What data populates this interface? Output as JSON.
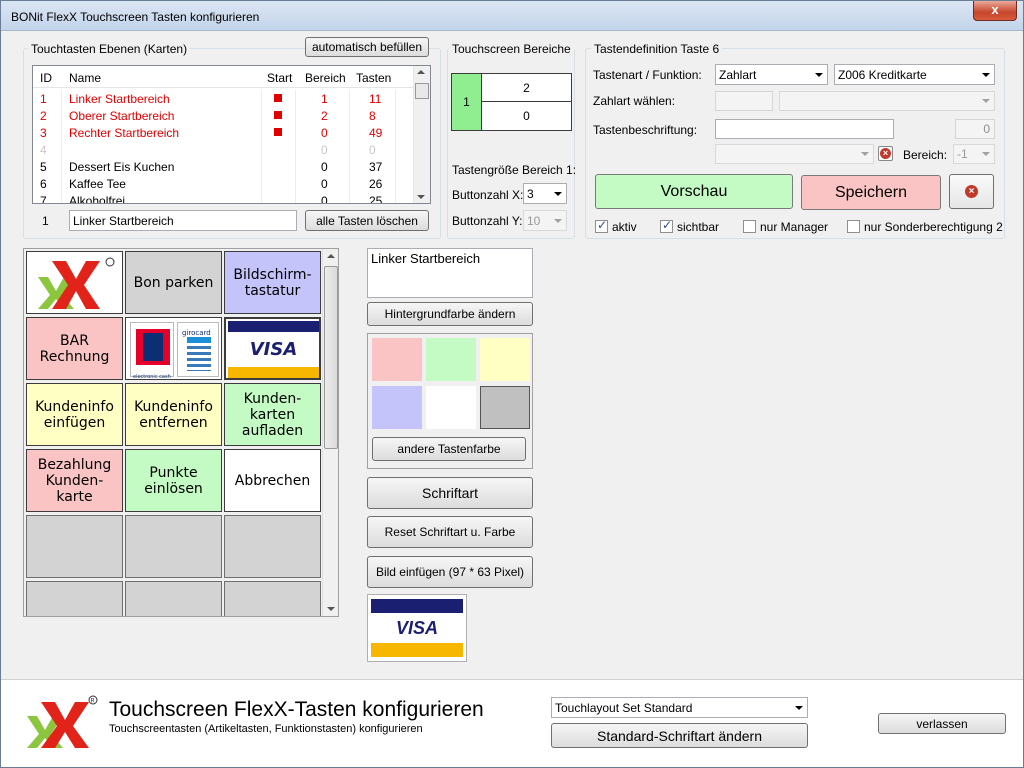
{
  "window": {
    "title": "BONit FlexX Touchscreen Tasten konfigurieren",
    "close": "x"
  },
  "layers": {
    "group_label": "Touchtasten Ebenen (Karten)",
    "autofill_button": "automatisch befüllen",
    "columns": [
      "ID",
      "Name",
      "Start",
      "Bereich",
      "Tasten"
    ],
    "rows": [
      {
        "id": "1",
        "name": "Linker Startbereich",
        "start": true,
        "bereich": "1",
        "tasten": "11",
        "style": "red"
      },
      {
        "id": "2",
        "name": "Oberer Startbereich",
        "start": true,
        "bereich": "2",
        "tasten": "8",
        "style": "red"
      },
      {
        "id": "3",
        "name": "Rechter Startbereich",
        "start": true,
        "bereich": "0",
        "tasten": "49",
        "style": "red"
      },
      {
        "id": "4",
        "name": "",
        "start": false,
        "bereich": "0",
        "tasten": "0",
        "style": "grey"
      },
      {
        "id": "5",
        "name": "Dessert Eis Kuchen",
        "start": false,
        "bereich": "0",
        "tasten": "37",
        "style": "normal"
      },
      {
        "id": "6",
        "name": "Kaffee Tee",
        "start": false,
        "bereich": "0",
        "tasten": "26",
        "style": "normal"
      },
      {
        "id": "7",
        "name": "Alkoholfrei",
        "start": false,
        "bereich": "0",
        "tasten": "25",
        "style": "normal"
      }
    ],
    "selected_id": "1",
    "selected_name": "Linker Startbereich",
    "delete_all_button": "alle Tasten löschen"
  },
  "areas": {
    "group_label": "Touchscreen Bereiche",
    "left_value": "1",
    "top_value": "2",
    "bottom_value": "0",
    "size_label": "Tastengröße Bereich 1:",
    "count_x_label": "Buttonzahl X:",
    "count_x_value": "3",
    "count_y_label": "Buttonzahl Y:",
    "count_y_value": "10"
  },
  "keydef": {
    "group_label": "Tastendefinition Taste 6",
    "type_label": "Tastenart / Funktion:",
    "type_value": "Zahlart",
    "function_value": "Z006 Kreditkarte",
    "payment_label": "Zahlart wählen:",
    "caption_label": "Tastenbeschriftung:",
    "caption_value": "",
    "caption_count": "0",
    "bereich_label": "Bereich:",
    "bereich_value": "-1",
    "preview_button": "Vorschau",
    "save_button": "Speichern",
    "checkboxes": [
      {
        "label": "aktiv",
        "checked": true
      },
      {
        "label": "sichtbar",
        "checked": true
      },
      {
        "label": "nur Manager",
        "checked": false
      },
      {
        "label": "nur Sonderberechtigung 2",
        "checked": false
      }
    ]
  },
  "keys": [
    {
      "label": "",
      "kind": "logo",
      "bg": "#ffffff"
    },
    {
      "label": "Bon parken",
      "kind": "text",
      "bg": "#d3d3d3"
    },
    {
      "label": "Bildschirm-\ntastatur",
      "kind": "text",
      "bg": "#c4c4fa"
    },
    {
      "label": "BAR\nRechnung",
      "kind": "text",
      "bg": "#fac4c4"
    },
    {
      "label": "",
      "kind": "ec",
      "bg": "#ffffff"
    },
    {
      "label": "VISA",
      "kind": "visa",
      "bg": "#ffffff"
    },
    {
      "label": "Kundeninfo\neinfügen",
      "kind": "text",
      "bg": "#ffffc4"
    },
    {
      "label": "Kundeninfo\nentfernen",
      "kind": "text",
      "bg": "#ffffc4"
    },
    {
      "label": "Kunden-\nkarten\naufladen",
      "kind": "text",
      "bg": "#c4fac4"
    },
    {
      "label": "Bezahlung\nKunden-\nkarte",
      "kind": "text",
      "bg": "#fac4c4"
    },
    {
      "label": "Punkte\neinlösen",
      "kind": "text",
      "bg": "#c4fac4"
    },
    {
      "label": "Abbrechen",
      "kind": "text",
      "bg": "#ffffff"
    },
    {
      "label": "",
      "kind": "empty",
      "bg": "#d3d3d3"
    },
    {
      "label": "",
      "kind": "empty",
      "bg": "#d3d3d3"
    },
    {
      "label": "",
      "kind": "empty",
      "bg": "#d3d3d3"
    },
    {
      "label": "",
      "kind": "empty",
      "bg": "#d3d3d3"
    },
    {
      "label": "",
      "kind": "empty",
      "bg": "#d3d3d3"
    },
    {
      "label": "",
      "kind": "empty",
      "bg": "#d3d3d3"
    }
  ],
  "editor": {
    "text_value": "Linker Startbereich",
    "bg_button": "Hintergrundfarbe ändern",
    "swatches": [
      "#fac4c4",
      "#c4fac4",
      "#ffffc4",
      "#c4c4fa",
      "#ffffff",
      "#c0c0c0"
    ],
    "other_color_button": "andere Tastenfarbe",
    "font_button": "Schriftart",
    "reset_button": "Reset Schriftart u. Farbe",
    "image_button": "Bild einfügen (97 * 63 Pixel)",
    "image_preview": "VISA"
  },
  "footer": {
    "title": "Touchscreen FlexX-Tasten konfigurieren",
    "subtitle": "Touchscreentasten (Artikeltasten, Funktionstasten) konfigurieren",
    "layout_value": "Touchlayout Set Standard",
    "default_font_button": "Standard-Schriftart ändern",
    "leave_button": "verlassen"
  },
  "colors": {
    "accent_red": "#e00000",
    "preview_green": "#c4fac4",
    "save_red": "#fac4c4"
  }
}
